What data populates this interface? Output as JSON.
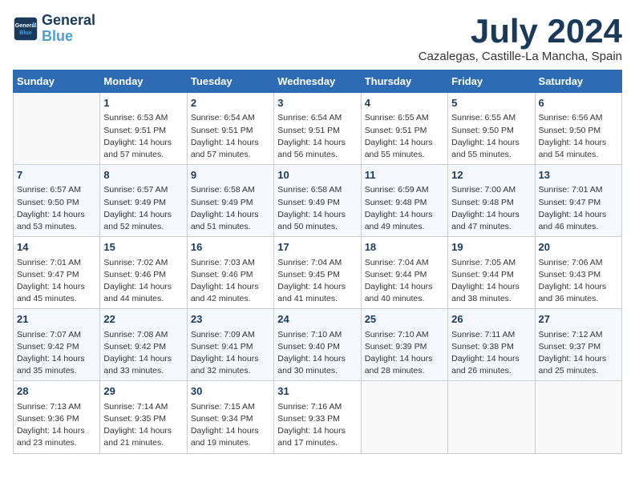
{
  "logo": {
    "line1": "General",
    "line2": "Blue"
  },
  "title": "July 2024",
  "subtitle": "Cazalegas, Castille-La Mancha, Spain",
  "weekdays": [
    "Sunday",
    "Monday",
    "Tuesday",
    "Wednesday",
    "Thursday",
    "Friday",
    "Saturday"
  ],
  "weeks": [
    [
      {
        "date": "",
        "sunrise": "",
        "sunset": "",
        "daylight": ""
      },
      {
        "date": "1",
        "sunrise": "6:53 AM",
        "sunset": "9:51 PM",
        "daylight": "14 hours and 57 minutes."
      },
      {
        "date": "2",
        "sunrise": "6:54 AM",
        "sunset": "9:51 PM",
        "daylight": "14 hours and 57 minutes."
      },
      {
        "date": "3",
        "sunrise": "6:54 AM",
        "sunset": "9:51 PM",
        "daylight": "14 hours and 56 minutes."
      },
      {
        "date": "4",
        "sunrise": "6:55 AM",
        "sunset": "9:51 PM",
        "daylight": "14 hours and 55 minutes."
      },
      {
        "date": "5",
        "sunrise": "6:55 AM",
        "sunset": "9:50 PM",
        "daylight": "14 hours and 55 minutes."
      },
      {
        "date": "6",
        "sunrise": "6:56 AM",
        "sunset": "9:50 PM",
        "daylight": "14 hours and 54 minutes."
      }
    ],
    [
      {
        "date": "7",
        "sunrise": "6:57 AM",
        "sunset": "9:50 PM",
        "daylight": "14 hours and 53 minutes."
      },
      {
        "date": "8",
        "sunrise": "6:57 AM",
        "sunset": "9:49 PM",
        "daylight": "14 hours and 52 minutes."
      },
      {
        "date": "9",
        "sunrise": "6:58 AM",
        "sunset": "9:49 PM",
        "daylight": "14 hours and 51 minutes."
      },
      {
        "date": "10",
        "sunrise": "6:58 AM",
        "sunset": "9:49 PM",
        "daylight": "14 hours and 50 minutes."
      },
      {
        "date": "11",
        "sunrise": "6:59 AM",
        "sunset": "9:48 PM",
        "daylight": "14 hours and 49 minutes."
      },
      {
        "date": "12",
        "sunrise": "7:00 AM",
        "sunset": "9:48 PM",
        "daylight": "14 hours and 47 minutes."
      },
      {
        "date": "13",
        "sunrise": "7:01 AM",
        "sunset": "9:47 PM",
        "daylight": "14 hours and 46 minutes."
      }
    ],
    [
      {
        "date": "14",
        "sunrise": "7:01 AM",
        "sunset": "9:47 PM",
        "daylight": "14 hours and 45 minutes."
      },
      {
        "date": "15",
        "sunrise": "7:02 AM",
        "sunset": "9:46 PM",
        "daylight": "14 hours and 44 minutes."
      },
      {
        "date": "16",
        "sunrise": "7:03 AM",
        "sunset": "9:46 PM",
        "daylight": "14 hours and 42 minutes."
      },
      {
        "date": "17",
        "sunrise": "7:04 AM",
        "sunset": "9:45 PM",
        "daylight": "14 hours and 41 minutes."
      },
      {
        "date": "18",
        "sunrise": "7:04 AM",
        "sunset": "9:44 PM",
        "daylight": "14 hours and 40 minutes."
      },
      {
        "date": "19",
        "sunrise": "7:05 AM",
        "sunset": "9:44 PM",
        "daylight": "14 hours and 38 minutes."
      },
      {
        "date": "20",
        "sunrise": "7:06 AM",
        "sunset": "9:43 PM",
        "daylight": "14 hours and 36 minutes."
      }
    ],
    [
      {
        "date": "21",
        "sunrise": "7:07 AM",
        "sunset": "9:42 PM",
        "daylight": "14 hours and 35 minutes."
      },
      {
        "date": "22",
        "sunrise": "7:08 AM",
        "sunset": "9:42 PM",
        "daylight": "14 hours and 33 minutes."
      },
      {
        "date": "23",
        "sunrise": "7:09 AM",
        "sunset": "9:41 PM",
        "daylight": "14 hours and 32 minutes."
      },
      {
        "date": "24",
        "sunrise": "7:10 AM",
        "sunset": "9:40 PM",
        "daylight": "14 hours and 30 minutes."
      },
      {
        "date": "25",
        "sunrise": "7:10 AM",
        "sunset": "9:39 PM",
        "daylight": "14 hours and 28 minutes."
      },
      {
        "date": "26",
        "sunrise": "7:11 AM",
        "sunset": "9:38 PM",
        "daylight": "14 hours and 26 minutes."
      },
      {
        "date": "27",
        "sunrise": "7:12 AM",
        "sunset": "9:37 PM",
        "daylight": "14 hours and 25 minutes."
      }
    ],
    [
      {
        "date": "28",
        "sunrise": "7:13 AM",
        "sunset": "9:36 PM",
        "daylight": "14 hours and 23 minutes."
      },
      {
        "date": "29",
        "sunrise": "7:14 AM",
        "sunset": "9:35 PM",
        "daylight": "14 hours and 21 minutes."
      },
      {
        "date": "30",
        "sunrise": "7:15 AM",
        "sunset": "9:34 PM",
        "daylight": "14 hours and 19 minutes."
      },
      {
        "date": "31",
        "sunrise": "7:16 AM",
        "sunset": "9:33 PM",
        "daylight": "14 hours and 17 minutes."
      },
      {
        "date": "",
        "sunrise": "",
        "sunset": "",
        "daylight": ""
      },
      {
        "date": "",
        "sunrise": "",
        "sunset": "",
        "daylight": ""
      },
      {
        "date": "",
        "sunrise": "",
        "sunset": "",
        "daylight": ""
      }
    ]
  ]
}
